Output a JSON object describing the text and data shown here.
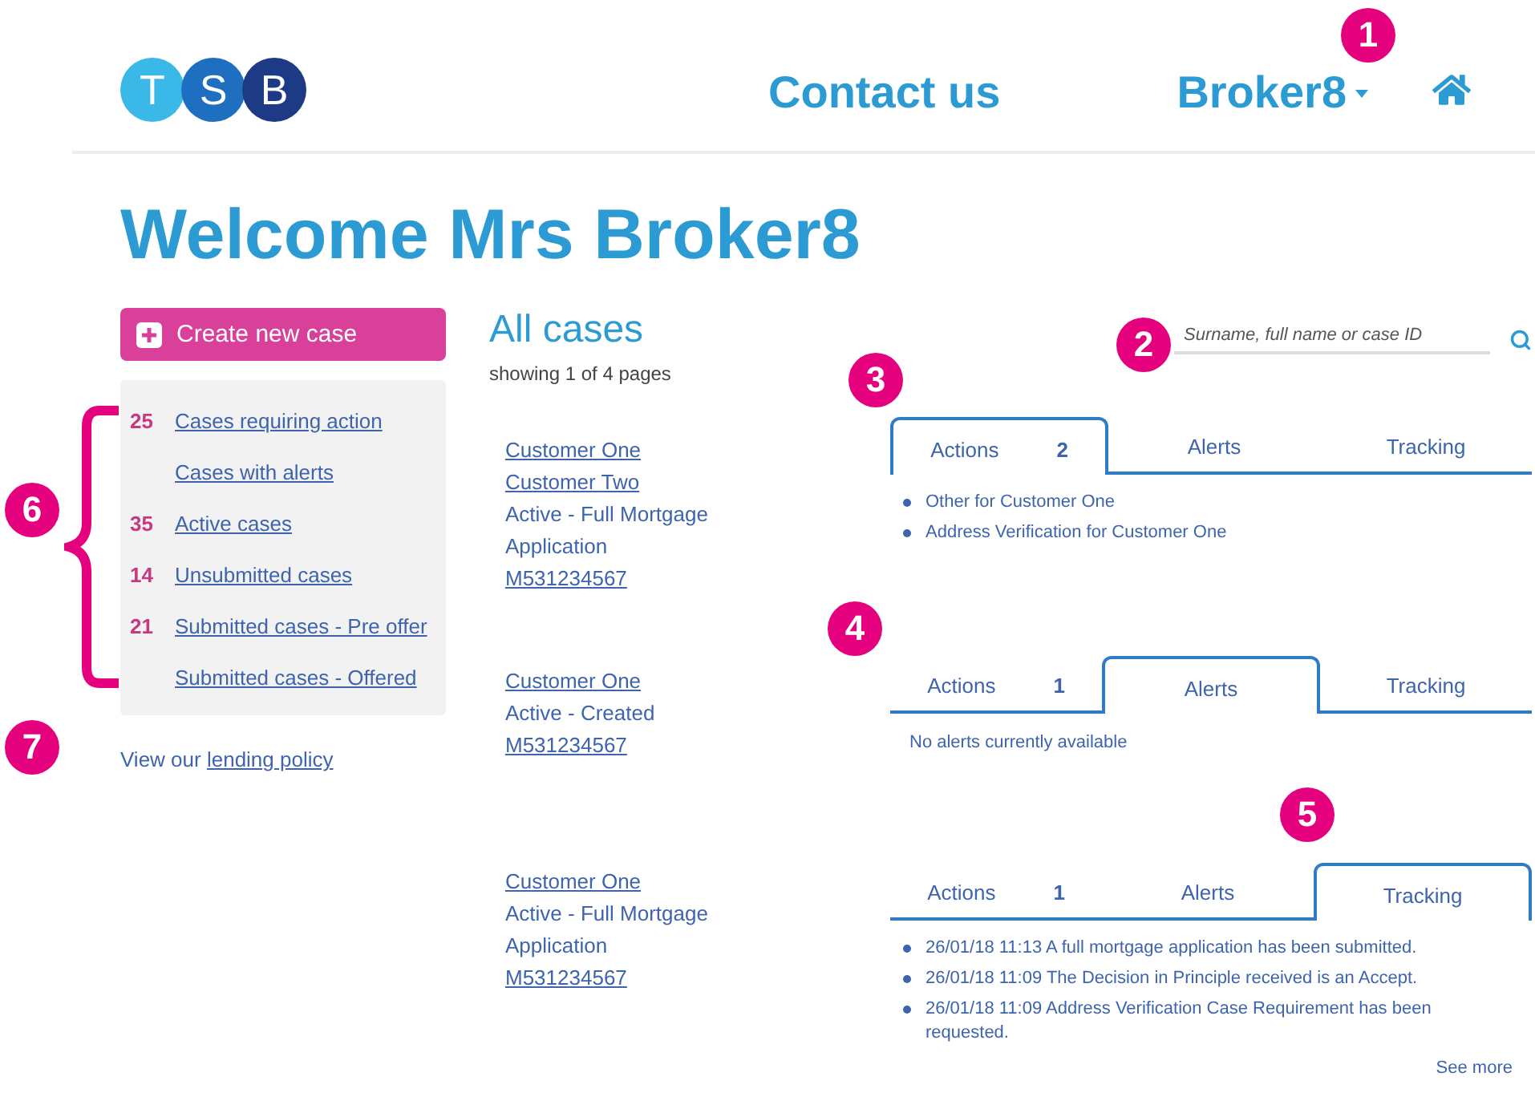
{
  "header": {
    "logo_letters": [
      "T",
      "S",
      "B"
    ],
    "contact": "Contact us",
    "user": "Broker8"
  },
  "welcome": "Welcome Mrs Broker8",
  "create_button": "Create new case",
  "sidebar": {
    "items": [
      {
        "count": "25",
        "label": "Cases requiring action"
      },
      {
        "label": "Cases with alerts"
      },
      {
        "count": "35",
        "label": "Active cases"
      },
      {
        "count": "14",
        "label": "Unsubmitted cases"
      },
      {
        "count": "21",
        "label": "Submitted cases - Pre offer"
      },
      {
        "label": "Submitted cases - Offered"
      }
    ],
    "policy_prefix": "View our",
    "policy_link": "lending policy"
  },
  "cases": {
    "title": "All cases",
    "subtitle": "showing 1 of 4 pages",
    "items": [
      {
        "lines": [
          {
            "kind": "link",
            "text": "Customer One"
          },
          {
            "kind": "link",
            "text": "Customer Two"
          },
          {
            "kind": "text",
            "text": "Active - Full Mortgage Application"
          },
          {
            "kind": "link",
            "text": "M531234567"
          }
        ]
      },
      {
        "lines": [
          {
            "kind": "link",
            "text": "Customer One"
          },
          {
            "kind": "text",
            "text": "Active - Created"
          },
          {
            "kind": "link",
            "text": "M531234567"
          }
        ]
      },
      {
        "lines": [
          {
            "kind": "link",
            "text": "Customer One"
          },
          {
            "kind": "text",
            "text": "Active - Full Mortgage Application"
          },
          {
            "kind": "link",
            "text": "M531234567"
          }
        ]
      }
    ]
  },
  "search": {
    "placeholder": "Surname, full name or case ID"
  },
  "panels": [
    {
      "tabs": [
        {
          "label": "Actions",
          "count": "2",
          "selected": true
        },
        {
          "label": "Alerts",
          "selected": false
        },
        {
          "label": "Tracking",
          "selected": false
        }
      ],
      "content": {
        "kind": "list",
        "items": [
          "Other for Customer One",
          "Address Verification for Customer One"
        ]
      }
    },
    {
      "tabs": [
        {
          "label": "Actions",
          "count": "1",
          "selected": false
        },
        {
          "label": "Alerts",
          "selected": true
        },
        {
          "label": "Tracking",
          "selected": false
        }
      ],
      "content": {
        "kind": "message",
        "text": "No alerts currently available"
      }
    },
    {
      "tabs": [
        {
          "label": "Actions",
          "count": "1",
          "selected": false
        },
        {
          "label": "Alerts",
          "selected": false
        },
        {
          "label": "Tracking",
          "selected": true
        }
      ],
      "content": {
        "kind": "list",
        "items": [
          "26/01/18 11:13 A full mortgage application has been submitted.",
          "26/01/18 11:09 The Decision in Principle received is an Accept.",
          "26/01/18 11:09 Address Verification Case Requirement has been requested."
        ]
      },
      "see_more": "See more"
    }
  ],
  "callouts": [
    "1",
    "2",
    "3",
    "4",
    "5",
    "6",
    "7"
  ]
}
